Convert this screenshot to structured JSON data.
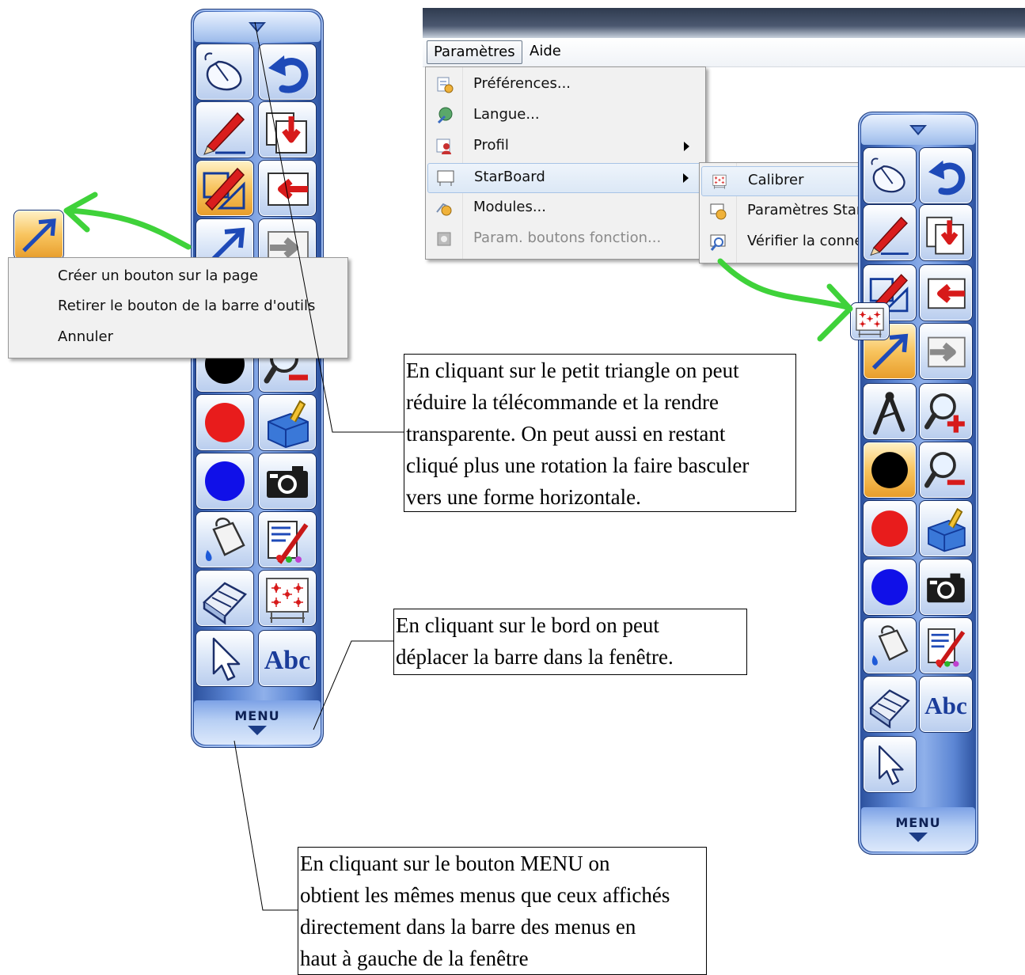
{
  "menubar": {
    "items": [
      "Paramètres",
      "Aide"
    ]
  },
  "parametres_menu": {
    "items": [
      {
        "label": "Préférences...",
        "icon": "preferences-icon"
      },
      {
        "label": "Langue...",
        "icon": "language-icon"
      },
      {
        "label": "Profil",
        "icon": "profile-icon",
        "submenu": true
      },
      {
        "label": "StarBoard",
        "icon": "starboard-icon",
        "submenu": true
      },
      {
        "label": "Modules...",
        "icon": "modules-icon"
      },
      {
        "label": "Param. boutons fonction...",
        "icon": "function-buttons-icon",
        "disabled": true
      }
    ]
  },
  "starboard_submenu": {
    "items": [
      {
        "label": "Calibrer",
        "icon": "calibrate-icon"
      },
      {
        "label": "Paramètres StarBoard",
        "icon": "starboard-settings-icon"
      },
      {
        "label": "Vérifier la connexion",
        "icon": "check-connection-icon"
      }
    ]
  },
  "context_menu": {
    "items": [
      "Créer un bouton sur la page",
      "Retirer le bouton de la barre d'outils",
      "Annuler"
    ]
  },
  "toolbar": {
    "menu_label": "MENU"
  },
  "callouts": {
    "triangle": [
      "En cliquant sur le petit triangle on peut",
      "réduire la télécommande et la rendre",
      "transparente. On peut aussi en restant",
      "cliqué plus une rotation la faire basculer",
      "vers une forme horizontale."
    ],
    "border": [
      "En cliquant sur le bord on peut",
      "déplacer la barre dans la fenêtre."
    ],
    "menu": [
      "En cliquant sur le bouton MENU on",
      "obtient les mêmes menus que ceux affichés",
      "directement dans la barre des menus en",
      "haut à gauche de la fenêtre"
    ]
  },
  "colors": {
    "toolbar_blue": "#5c86d4",
    "highlight_orange": "#f8c45e",
    "annotation_green": "#3fd23a",
    "black_pen": "#000000",
    "red_pen": "#e81c1c",
    "blue_pen": "#1010e8"
  }
}
